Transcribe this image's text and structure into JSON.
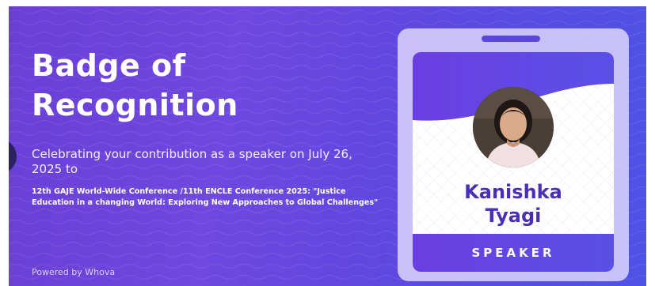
{
  "banner": {
    "title": "Badge of Recognition",
    "subtitle": "Celebrating your contribution as a speaker on July 26, 2025 to",
    "conference": "12th GAJE World-Wide Conference /11th ENCLE Conference 2025: \"Justice Education in a changing World: Exploring New Approaches to Global Challenges\"",
    "footer": "Powered by Whova"
  },
  "badge": {
    "first_name": "Kanishka",
    "last_name": "Tyagi",
    "role": "SPEAKER"
  },
  "colors": {
    "banner_start": "#6a3fd6",
    "banner_end": "#4d53e6",
    "name_text": "#4a2fb6",
    "role_bar": "#6a3ee0"
  }
}
